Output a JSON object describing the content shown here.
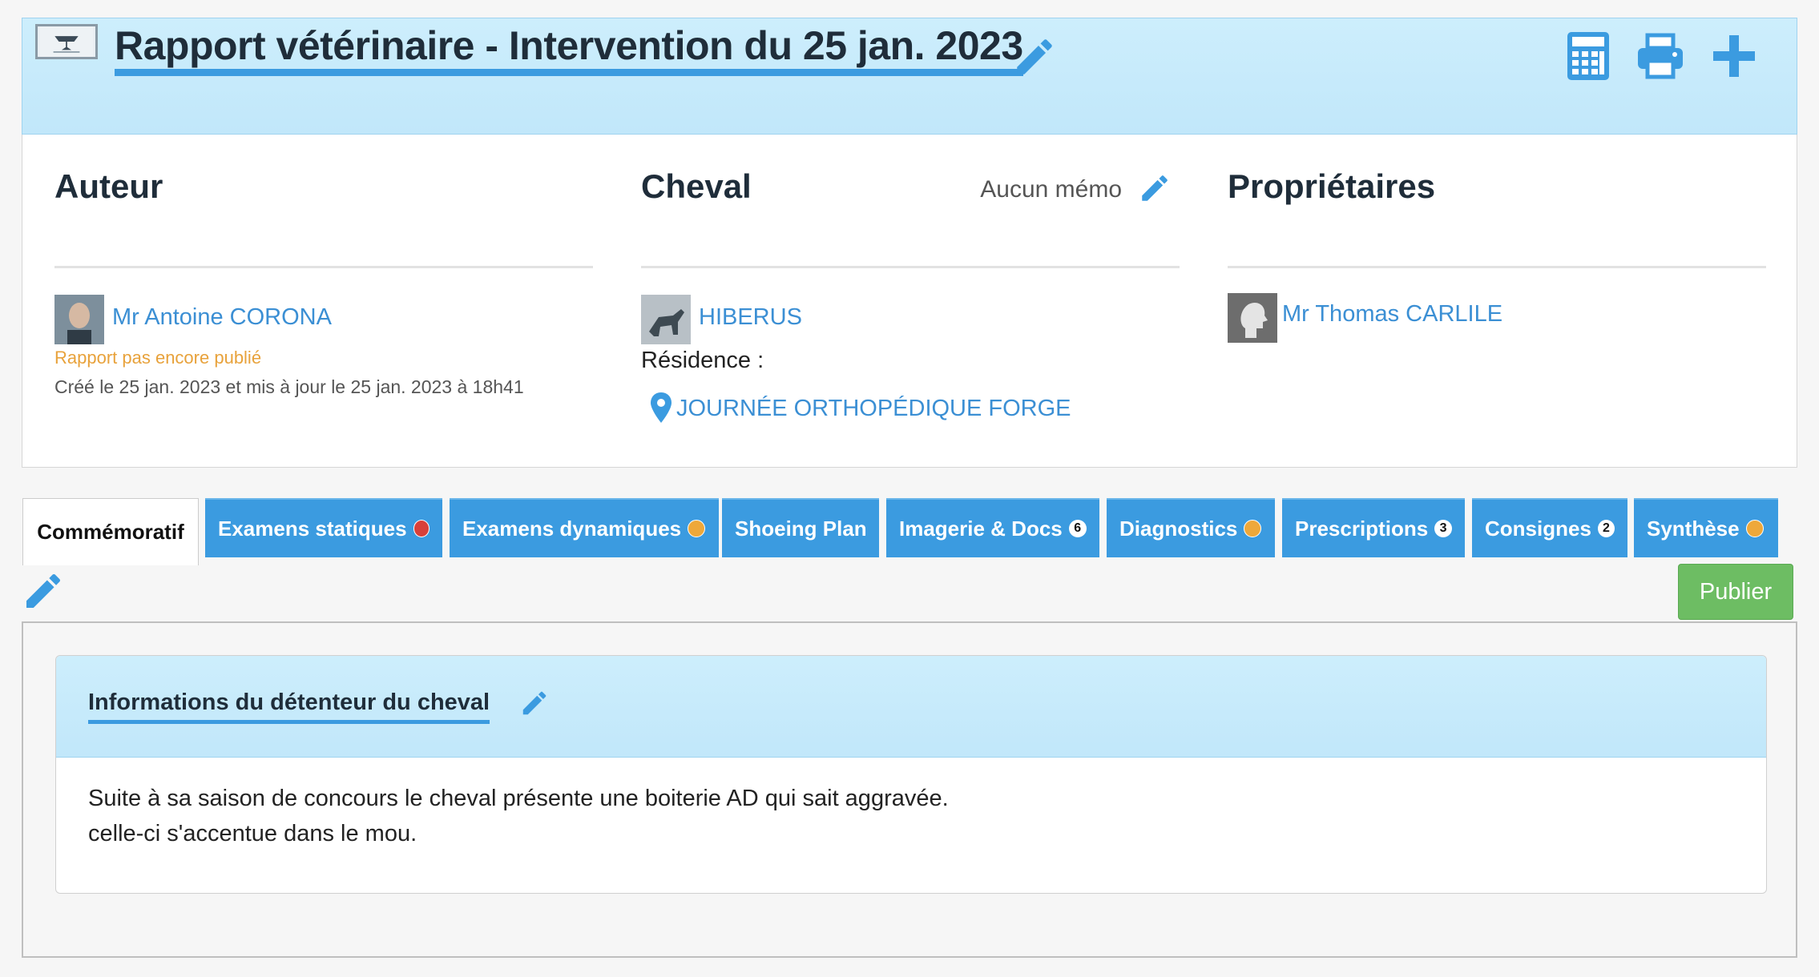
{
  "header": {
    "title": "Rapport vétérinaire - Intervention du 25 jan. 2023",
    "icons": [
      "calculator-icon",
      "print-icon",
      "plus-icon"
    ]
  },
  "author": {
    "heading": "Auteur",
    "name": "Mr Antoine CORONA",
    "status": "Rapport pas encore publié",
    "dates": "Créé le 25 jan. 2023 et mis à jour le 25 jan. 2023 à 18h41"
  },
  "horse": {
    "heading": "Cheval",
    "memo": "Aucun mémo",
    "name": "HIBERUS",
    "residence_label": "Résidence :",
    "residence_value": "JOURNÉE ORTHOPÉDIQUE FORGE"
  },
  "owners": {
    "heading": "Propriétaires",
    "name": "Mr Thomas CARLILE"
  },
  "tabs": [
    {
      "label": "Commémoratif"
    },
    {
      "label": "Examens statiques"
    },
    {
      "label": "Examens dynamiques"
    },
    {
      "label": "Shoeing Plan"
    },
    {
      "label": "Imagerie & Docs",
      "count": "6"
    },
    {
      "label": "Diagnostics"
    },
    {
      "label": "Prescriptions",
      "count": "3"
    },
    {
      "label": "Consignes",
      "count": "2"
    },
    {
      "label": "Synthèse"
    }
  ],
  "colors": {
    "accent": "#3b9be0",
    "status_red": "#d8403a",
    "status_orange": "#eea83a",
    "publish": "#6dbd63"
  },
  "publish_label": "Publier",
  "section": {
    "title": "Informations du détenteur du cheval",
    "line1": "Suite à sa saison de concours le cheval présente une boiterie AD qui sait aggravée.",
    "line2": "celle-ci s'accentue dans le mou."
  }
}
